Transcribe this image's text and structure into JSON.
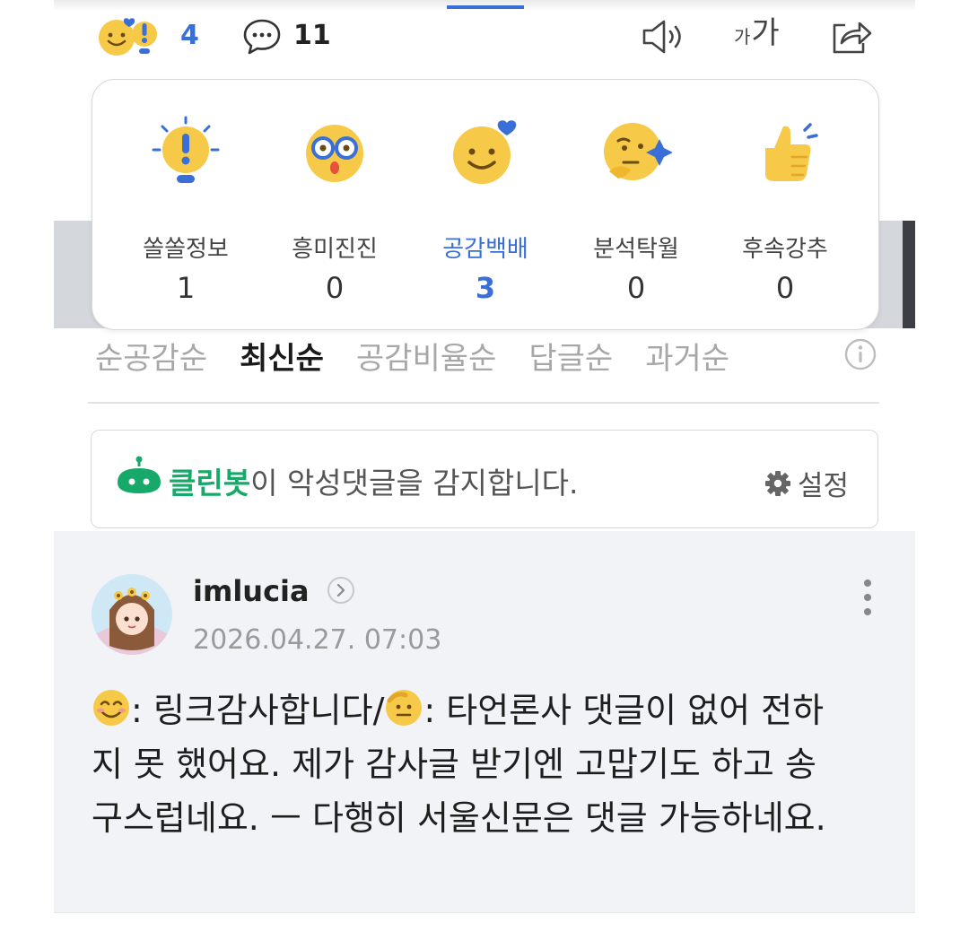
{
  "header": {
    "reaction_count": "4",
    "comment_count": "11",
    "font_size_small": "가",
    "font_size_large": "가",
    "icons": [
      "smile-heart-icon",
      "exclamation-icon",
      "comment-bubble-icon",
      "speaker-icon",
      "share-icon"
    ]
  },
  "reactions": [
    {
      "label": "쏠쏠정보",
      "count": "1",
      "icon": "bulb-exclamation-icon"
    },
    {
      "label": "흥미진진",
      "count": "0",
      "icon": "glasses-face-icon"
    },
    {
      "label": "공감백배",
      "count": "3",
      "icon": "smile-heart-icon",
      "selected": true
    },
    {
      "label": "분석탁월",
      "count": "0",
      "icon": "thinking-face-icon"
    },
    {
      "label": "후속강추",
      "count": "0",
      "icon": "thumbs-up-icon"
    }
  ],
  "sort_tabs": [
    {
      "label": "순공감순"
    },
    {
      "label": "최신순",
      "active": true
    },
    {
      "label": "공감비율순"
    },
    {
      "label": "답글순"
    },
    {
      "label": "과거순"
    }
  ],
  "cleanbot": {
    "brand": "클린봇",
    "message": "이 악성댓글을 감지합니다.",
    "setting_label": "설정"
  },
  "comment": {
    "author": "imlucia",
    "timestamp": "2026.04.27. 07:03",
    "text_part1": ": 링크감사합니다/",
    "text_part2": ": 타언론사 댓글이 없어 전하지 못 했어요. 제가 감사글 받기엔 고맙기도 하고 송구스럽네요. ㅡ 다행히 서울신문은 댓글 가능하네요."
  },
  "colors": {
    "accent": "#3a6fd8",
    "cleanbot_green": "#17a96a",
    "emoji_yellow": "#f7c948"
  }
}
